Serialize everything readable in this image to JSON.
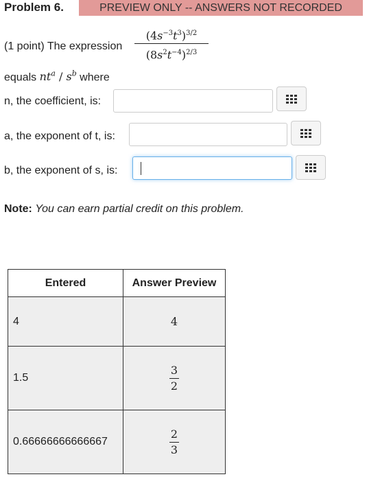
{
  "header": {
    "problem_title": "Problem 6.",
    "preview_banner": "PREVIEW ONLY -- ANSWERS NOT RECORDED"
  },
  "problem": {
    "intro": "(1 point) The expression",
    "expression": {
      "numerator": {
        "open": "(4",
        "base1": "s",
        "exp1": "−3",
        "base2": "t",
        "exp2": "3",
        "close": ")",
        "outer_exp": "3/2"
      },
      "denominator": {
        "open": "(8",
        "base1": "s",
        "exp1": "2",
        "base2": "t",
        "exp2": "−4",
        "close": ")",
        "outer_exp": "2/3"
      }
    },
    "equals_prefix": "equals ",
    "target": {
      "n": "n",
      "t": "t",
      "a": "a",
      "slash": " / ",
      "s": "s",
      "b": "b"
    },
    "equals_suffix": " where"
  },
  "fields": [
    {
      "label": "n, the coefficient, is:",
      "value": "",
      "focused": false
    },
    {
      "label": "a, the exponent of t, is:",
      "value": "",
      "focused": false
    },
    {
      "label": "b, the exponent of s, is:",
      "value": "",
      "focused": true
    }
  ],
  "note": {
    "bold": "Note:",
    "italic": "You can earn partial credit on this problem."
  },
  "answer_table": {
    "headers": [
      "Entered",
      "Answer Preview"
    ],
    "rows": [
      {
        "entered": "4",
        "preview_plain": "4"
      },
      {
        "entered": "1.5",
        "preview_num": "3",
        "preview_den": "2"
      },
      {
        "entered": "0.66666666666667",
        "preview_num": "2",
        "preview_den": "3"
      }
    ]
  },
  "icons": {
    "equation_editor": "keypad-grid-icon"
  }
}
